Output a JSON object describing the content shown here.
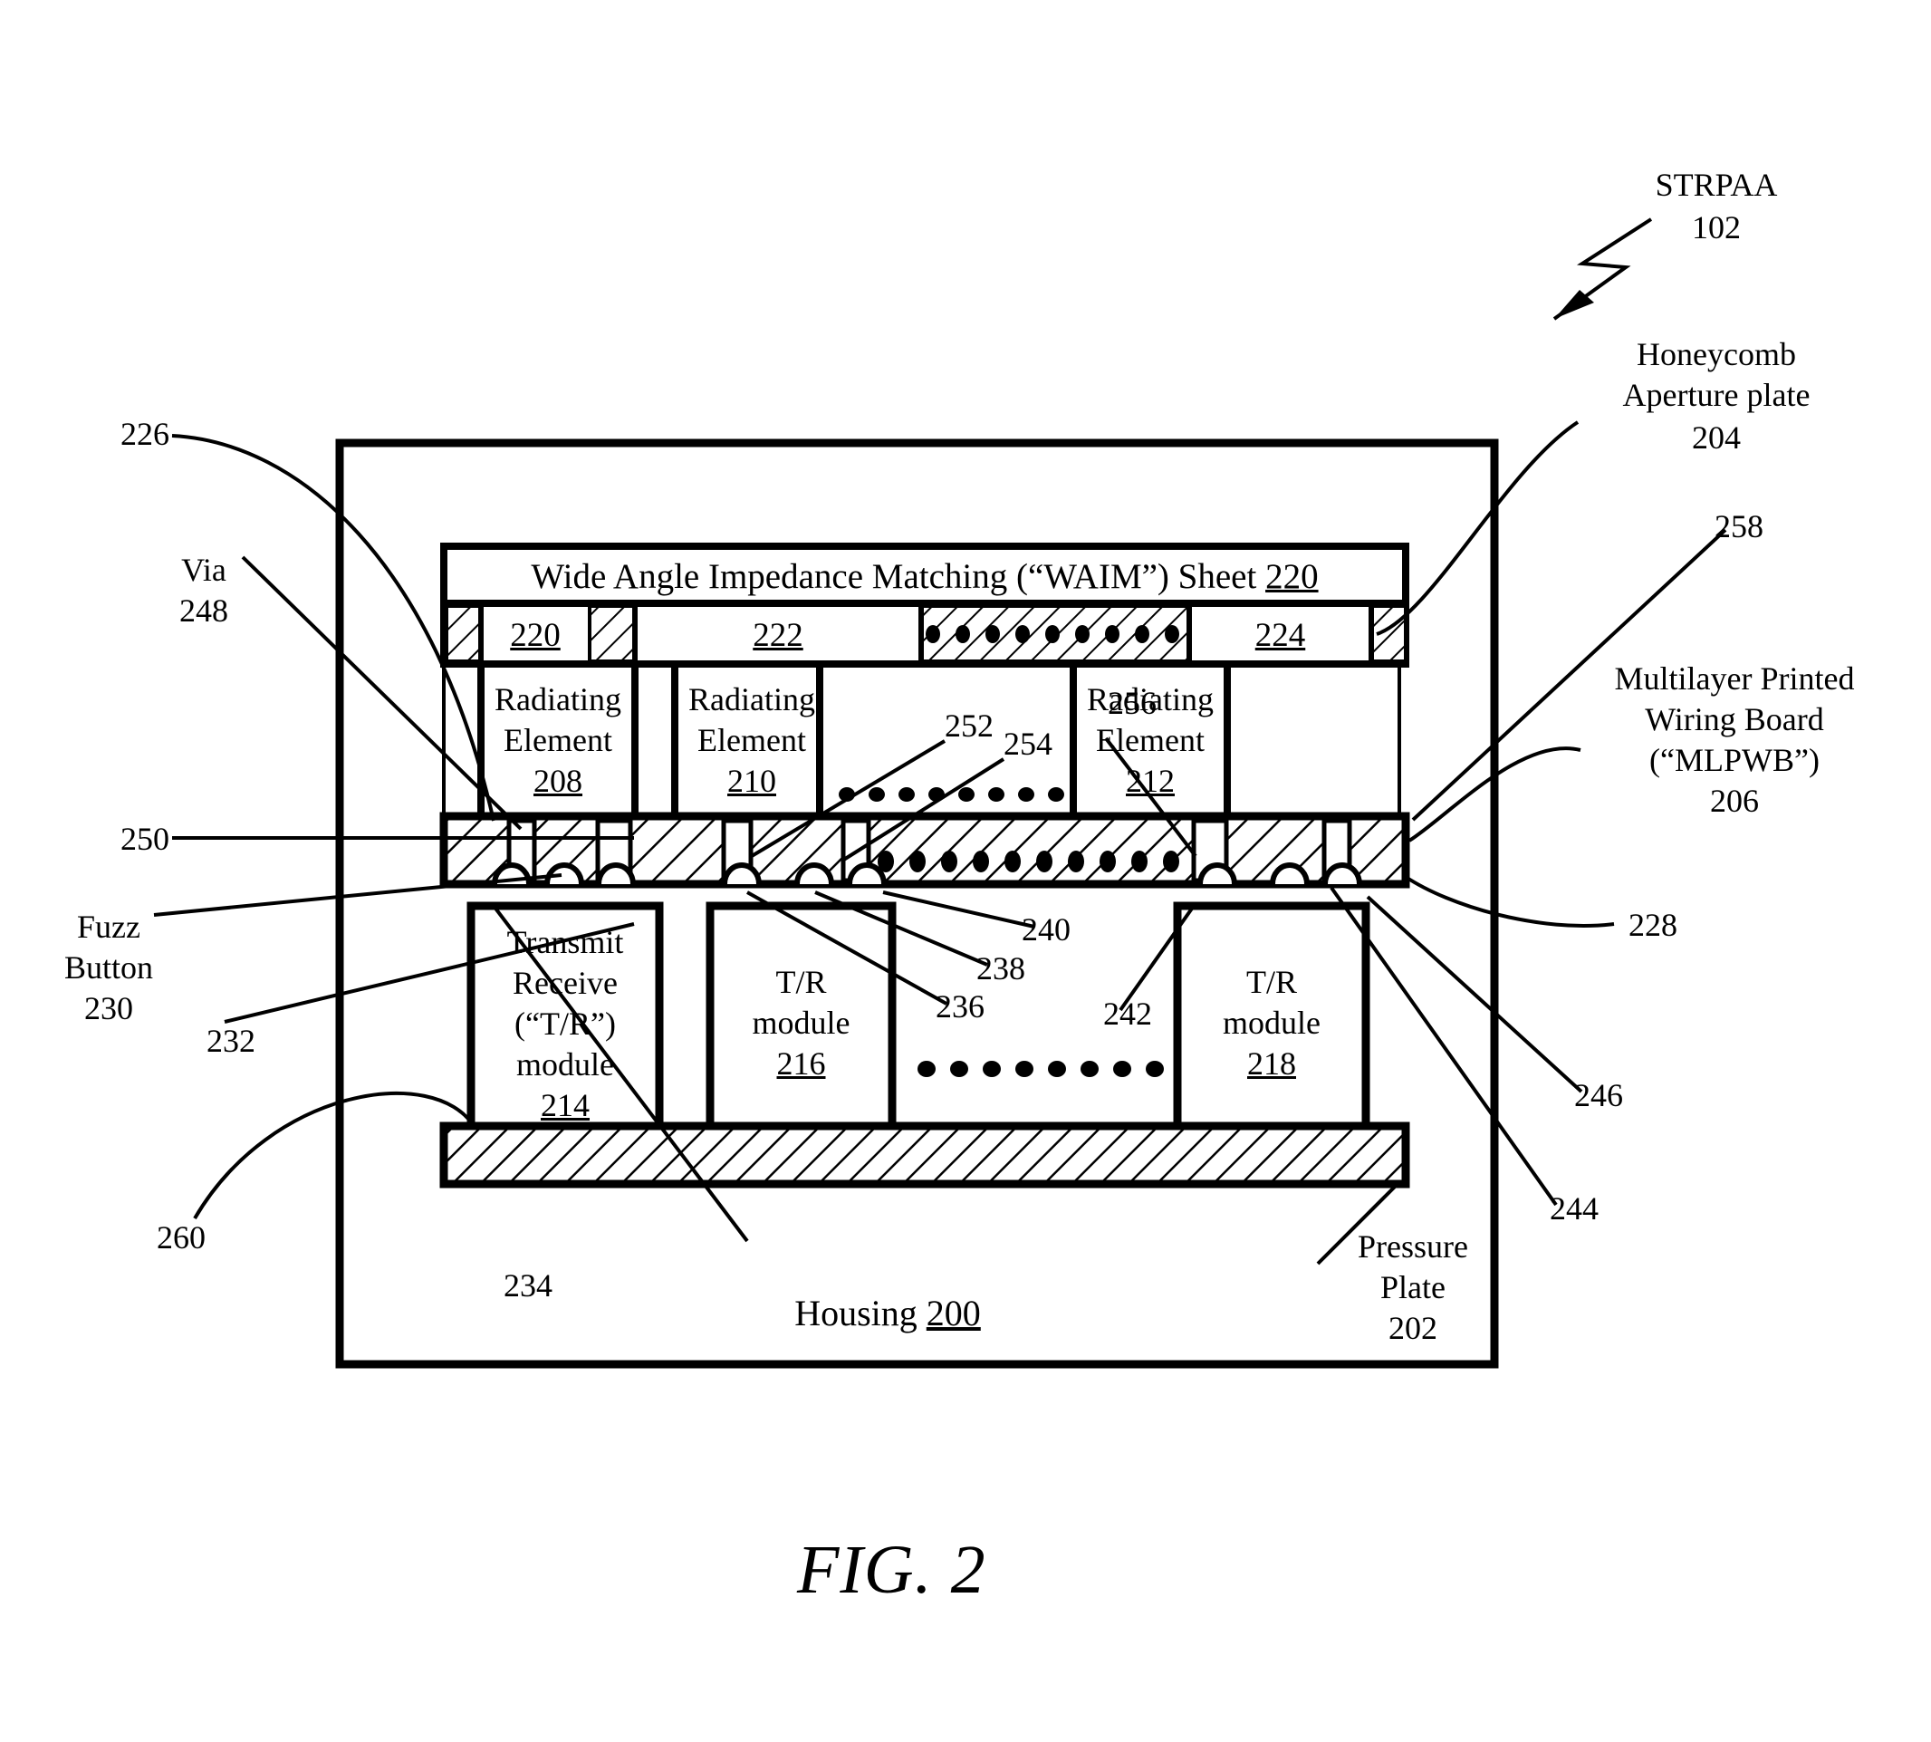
{
  "figure": {
    "caption": "FIG. 2",
    "title_ref": "STRPAA",
    "title_num": "102"
  },
  "callouts": {
    "honeycomb": {
      "line1": "Honeycomb",
      "line2": "Aperture plate",
      "num": "204"
    },
    "mlpwb": {
      "line1": "Multilayer Printed",
      "line2": "Wiring Board",
      "line3": "(“MLPWB”)",
      "num": "206"
    },
    "pressure_plate": {
      "line1": "Pressure",
      "line2": "Plate",
      "num": "202"
    },
    "via": {
      "line1": "Via",
      "num": "248"
    },
    "fuzz_button": {
      "line1": "Fuzz",
      "line2": "Button",
      "num": "230"
    }
  },
  "ref_numbers": {
    "n226": "226",
    "n258": "258",
    "n250": "250",
    "n232": "232",
    "n260": "260",
    "n234": "234",
    "n228": "228",
    "n246": "246",
    "n244": "244",
    "n242": "242",
    "n240": "240",
    "n238": "238",
    "n236": "236",
    "n252": "252",
    "n254": "254",
    "n256": "256"
  },
  "diagram": {
    "housing": {
      "label": "Housing ",
      "num": "200"
    },
    "waim_sheet": {
      "label": "Wide Angle Impedance Matching (“WAIM”) Sheet ",
      "num": "220"
    },
    "aperture_cells": [
      {
        "num": "220"
      },
      {
        "num": "222"
      },
      {
        "num": "",
        "dots": true
      },
      {
        "num": "224"
      }
    ],
    "radiating_elements": [
      {
        "line1": "Radiating",
        "line2": "Element",
        "num": "208"
      },
      {
        "line1": "Radiating",
        "line2": "Element",
        "num": "210"
      },
      {
        "line1": "Radiating",
        "line2": "Element",
        "num": "212"
      }
    ],
    "tr_modules": [
      {
        "line1": "Transmit",
        "line2": "Receive",
        "line3": "(“T/R”)",
        "line4": "module",
        "num": "214"
      },
      {
        "line1": "T/R",
        "line2": "module",
        "num": "216"
      },
      {
        "line1": "T/R",
        "line2": "module",
        "num": "218"
      }
    ]
  }
}
